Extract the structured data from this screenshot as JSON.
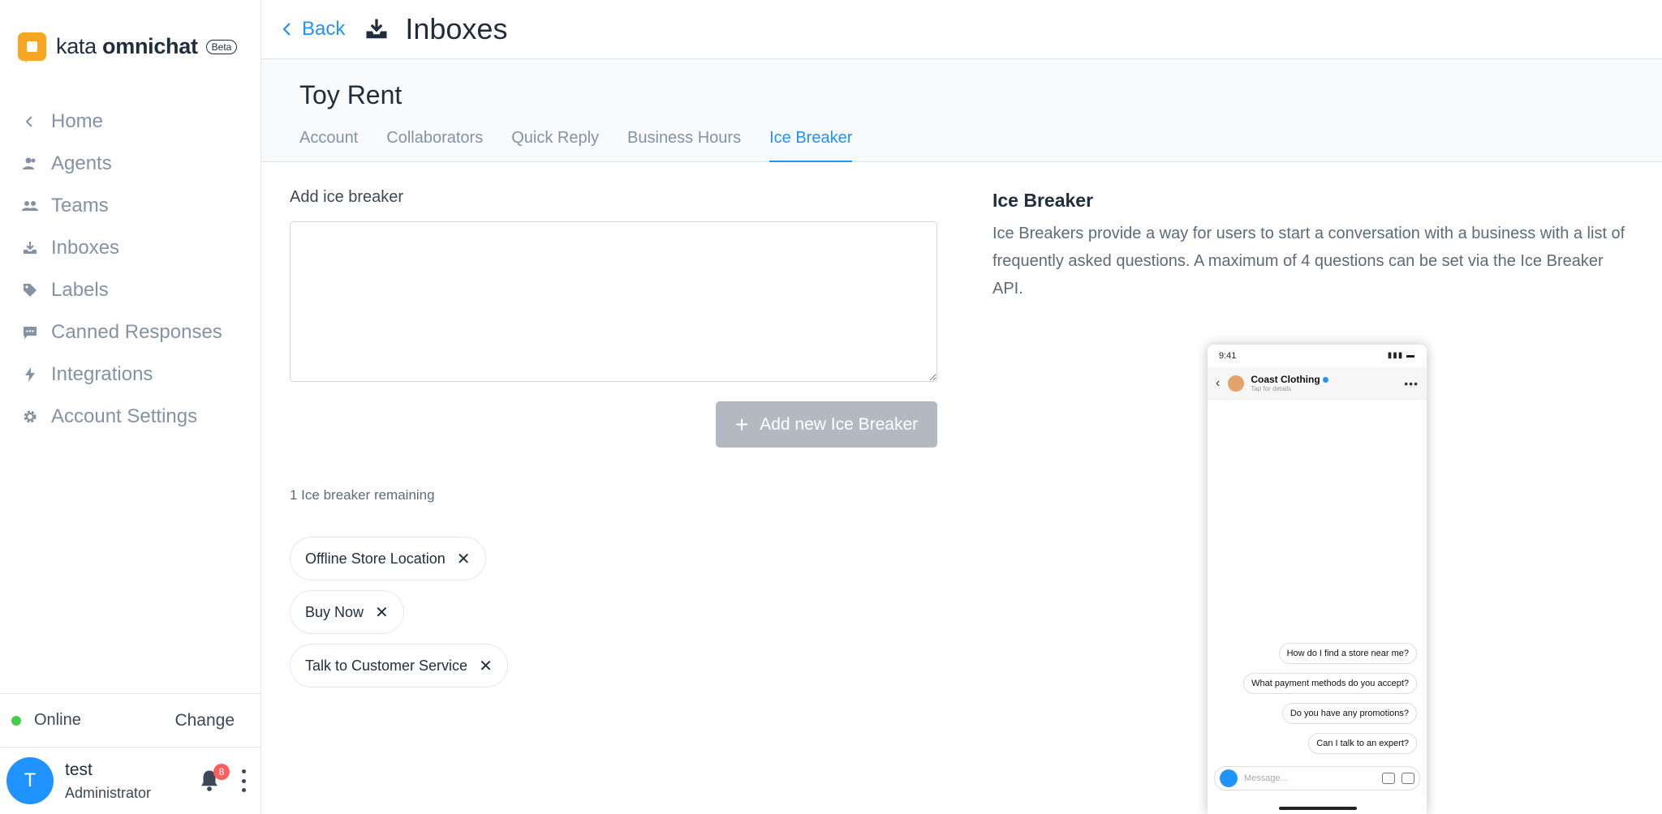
{
  "brand": {
    "name_light": "kata",
    "name_bold": "omnichat",
    "badge": "Beta"
  },
  "sidebar": {
    "items": [
      {
        "label": "Home",
        "icon": "chevron-left-icon"
      },
      {
        "label": "Agents",
        "icon": "agents-icon"
      },
      {
        "label": "Teams",
        "icon": "teams-icon"
      },
      {
        "label": "Inboxes",
        "icon": "inbox-icon"
      },
      {
        "label": "Labels",
        "icon": "tag-icon"
      },
      {
        "label": "Canned Responses",
        "icon": "chat-icon"
      },
      {
        "label": "Integrations",
        "icon": "bolt-icon"
      },
      {
        "label": "Account Settings",
        "icon": "gear-icon"
      }
    ],
    "status": {
      "label": "Online",
      "change": "Change",
      "color": "#44ce4b"
    },
    "user": {
      "initial": "T",
      "name": "test",
      "role": "Administrator",
      "notifications": "8"
    }
  },
  "header": {
    "back": "Back",
    "title": "Inboxes"
  },
  "inbox": {
    "name": "Toy Rent",
    "tabs": [
      "Account",
      "Collaborators",
      "Quick Reply",
      "Business Hours",
      "Ice Breaker"
    ],
    "active_tab": "Ice Breaker"
  },
  "form": {
    "label": "Add ice breaker",
    "value": "",
    "button": "Add new Ice Breaker",
    "remaining": "1 Ice breaker remaining",
    "chips": [
      "Offline Store Location",
      "Buy Now",
      "Talk to Customer Service"
    ]
  },
  "info": {
    "title": "Ice Breaker",
    "description": "Ice Breakers provide a way for users to start a conversation with a business with a list of frequently asked questions. A maximum of 4 questions can be set via the Ice Breaker API."
  },
  "preview": {
    "time": "9:41",
    "business": "Coast Clothing",
    "business_sub": "Tap for details",
    "questions": [
      "How do I find a store near me?",
      "What payment methods do you accept?",
      "Do you have any promotions?",
      "Can I talk to an expert?"
    ],
    "message_placeholder": "Message..."
  },
  "colors": {
    "accent": "#1f93ff",
    "button_disabled": "#b3b9c1",
    "badge": "#ff5e5e"
  }
}
